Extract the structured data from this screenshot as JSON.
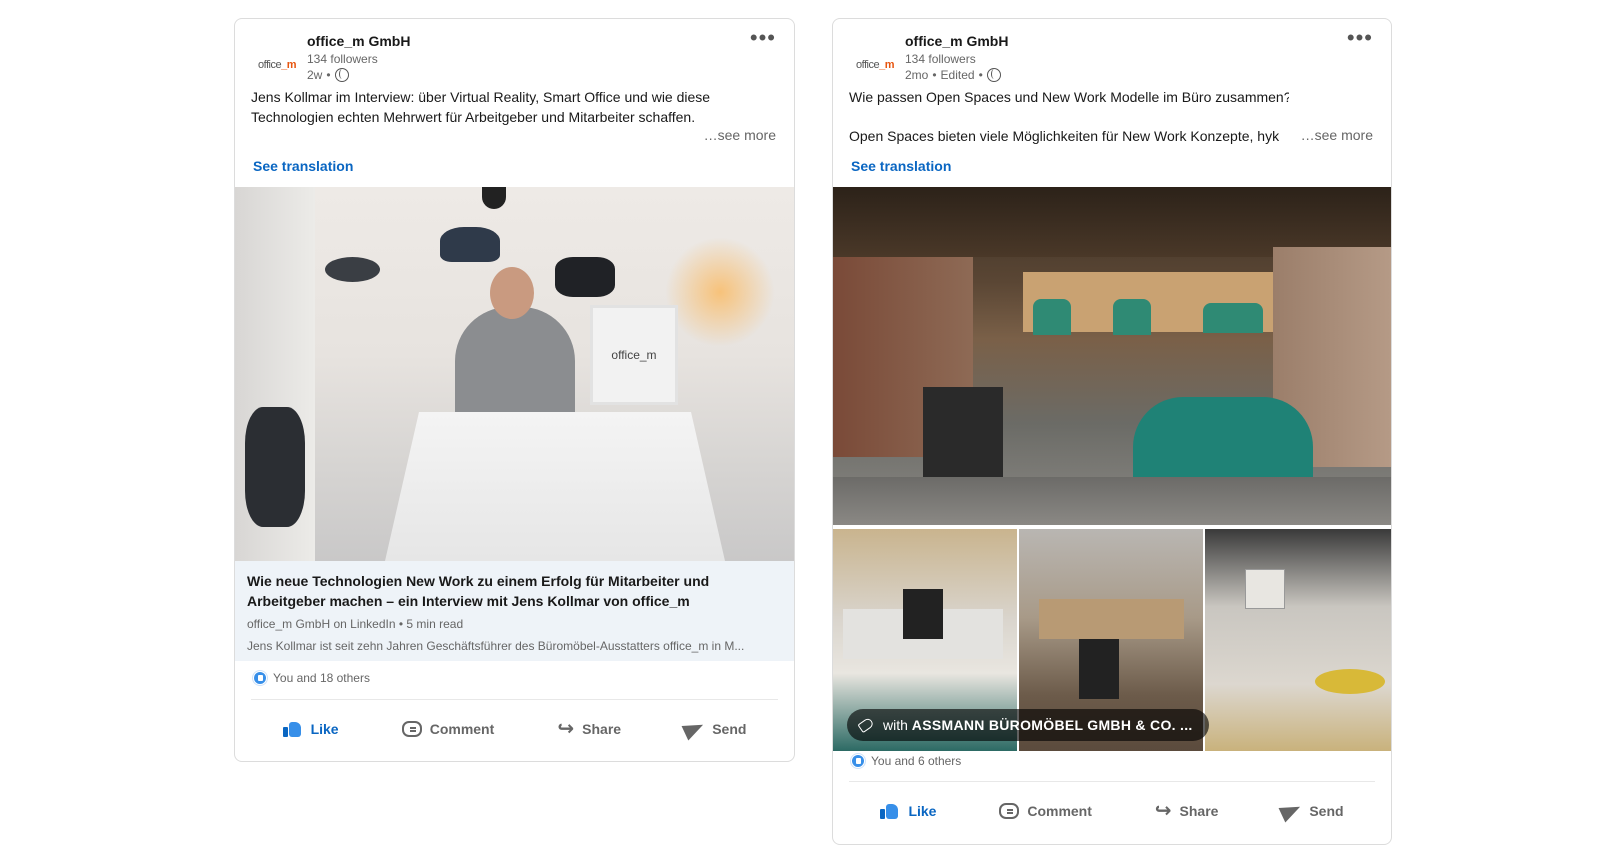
{
  "posts": [
    {
      "company": "office_m GmbH",
      "followers": "134 followers",
      "time": "2w",
      "logo_text_a": "office",
      "logo_text_b": "_m",
      "body_lines": [
        "Jens Kollmar im Interview: über Virtual Reality, Smart Office und wie diese",
        "Technologien echten Mehrwert für Arbeitgeber und Mitarbeiter schaffen."
      ],
      "see_more": "…see more",
      "see_translation": "See translation",
      "image_sign": "office_m",
      "article": {
        "title": "Wie neue Technologien New Work zu einem Erfolg für Mitarbeiter und Arbeitgeber machen – ein Interview mit Jens Kollmar von office_m",
        "source": "office_m GmbH on LinkedIn",
        "read_time": "5 min read",
        "description": "Jens Kollmar ist seit zehn Jahren Geschäftsführer des Büromöbel-Ausstatters office_m in M..."
      },
      "reactions": "You and 18 others",
      "actions": {
        "like": "Like",
        "comment": "Comment",
        "share": "Share",
        "send": "Send"
      }
    },
    {
      "company": "office_m GmbH",
      "followers": "134 followers",
      "time": "2mo",
      "edited": "Edited",
      "logo_text_a": "office",
      "logo_text_b": "_m",
      "body_lines": [
        "Wie passen Open Spaces und New Work Modelle im Büro zusammen?",
        "Open Spaces bieten viele Möglichkeiten für New Work Konzepte, hyk"
      ],
      "see_more": "…see more",
      "see_translation": "See translation",
      "tag": {
        "prefix": "with",
        "company": "ASSMANN BÜROMÖBEL GMBH & CO. ..."
      },
      "reactions": "You and 6 others",
      "actions": {
        "like": "Like",
        "comment": "Comment",
        "share": "Share",
        "send": "Send"
      }
    }
  ],
  "colors": {
    "link_blue": "#0a66c2",
    "like_blue": "#378fe9",
    "article_bg": "#eef3f8",
    "brand_orange": "#e7550f"
  },
  "icons": [
    "more-icon",
    "globe-icon",
    "like-icon",
    "comment-icon",
    "share-icon",
    "send-icon",
    "tag-icon"
  ]
}
